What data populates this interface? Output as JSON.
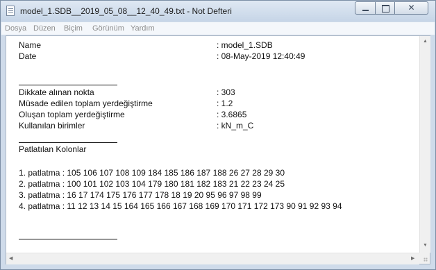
{
  "window": {
    "title": "model_1.SDB__2019_05_08__12_40_49.txt - Not Defteri",
    "close_glyph": "✕"
  },
  "menu": [
    "Dosya",
    "Düzen",
    "Biçim",
    "Görünüm",
    "Yardım"
  ],
  "document": {
    "name_label": "Name",
    "name_value": ": model_1.SDB",
    "date_label": "Date",
    "date_value": ": 08-May-2019 12:40:49",
    "stats": [
      {
        "label": "Dikkate alınan nokta",
        "value": ": 303"
      },
      {
        "label": "Müsade edilen toplam yerdeğiştirme",
        "value": ": 1.2"
      },
      {
        "label": "Oluşan toplam yerdeğiştirme",
        "value": ": 3.6865"
      },
      {
        "label": "Kullanılan birimler",
        "value": ": kN_m_C"
      }
    ],
    "section_title": "Patlatılan Kolonlar",
    "explosions": [
      "1. patlatma : 105 106 107 108 109 184 185 186 187 188 26 27 28 29 30",
      "2. patlatma : 100 101 102 103 104 179 180 181 182 183 21 22 23 24 25",
      "3. patlatma : 16 17 174 175 176 177 178 18 19 20 95 96 97 98 99",
      "4. patlatma : 11 12 13 14 15 164 165 166 167 168 169 170 171 172 173 90 91 92 93 94"
    ]
  },
  "scrollbar": {
    "up_glyph": "▲",
    "down_glyph": "▼",
    "left_glyph": "◀",
    "right_glyph": "▶"
  },
  "icons": {
    "app": "notepad-icon",
    "minimize": "minimize-icon",
    "maximize": "maximize-icon",
    "close": "close-icon"
  }
}
